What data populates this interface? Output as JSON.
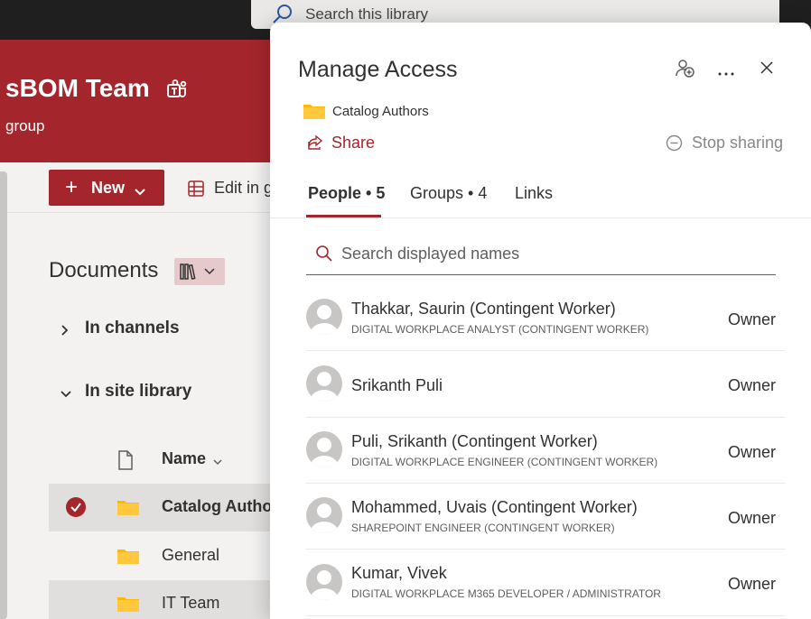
{
  "topbar": {
    "search_placeholder": "Search this library"
  },
  "site": {
    "title": "sBOM Team",
    "subtitle": "group"
  },
  "commandbar": {
    "new_label": "New",
    "edit_grid_label": "Edit in g"
  },
  "nav": {
    "documents_label": "Documents",
    "in_channels_label": "In channels",
    "in_site_library_label": "In site library"
  },
  "files": {
    "name_header": "Name",
    "rows": [
      {
        "name": "Catalog Author",
        "selected": true
      },
      {
        "name": "General",
        "selected": false
      },
      {
        "name": "IT Team",
        "selected": false
      }
    ]
  },
  "panel": {
    "title": "Manage Access",
    "item_name": "Catalog Authors",
    "share_label": "Share",
    "stop_sharing_label": "Stop sharing",
    "tabs": [
      {
        "label": "People • 5",
        "active": true
      },
      {
        "label": "Groups • 4",
        "active": false
      },
      {
        "label": "Links",
        "active": false
      }
    ],
    "search_placeholder": "Search displayed names",
    "people": [
      {
        "name": "Thakkar, Saurin (Contingent Worker)",
        "title": "DIGITAL WORKPLACE ANALYST (CONTINGENT WORKER)",
        "role": "Owner"
      },
      {
        "name": "Srikanth Puli",
        "title": "",
        "role": "Owner"
      },
      {
        "name": "Puli, Srikanth (Contingent Worker)",
        "title": "DIGITAL WORKPLACE ENGINEER (CONTINGENT WORKER)",
        "role": "Owner"
      },
      {
        "name": "Mohammed, Uvais (Contingent Worker)",
        "title": "SHAREPOINT ENGINEER (CONTINGENT WORKER)",
        "role": "Owner"
      },
      {
        "name": "Kumar, Vivek",
        "title": "DIGITAL WORKPLACE M365 DEVELOPER / ADMINISTRATOR",
        "role": "Owner"
      }
    ]
  },
  "colors": {
    "brand": "#a4262c",
    "folder": "#ffb900"
  }
}
